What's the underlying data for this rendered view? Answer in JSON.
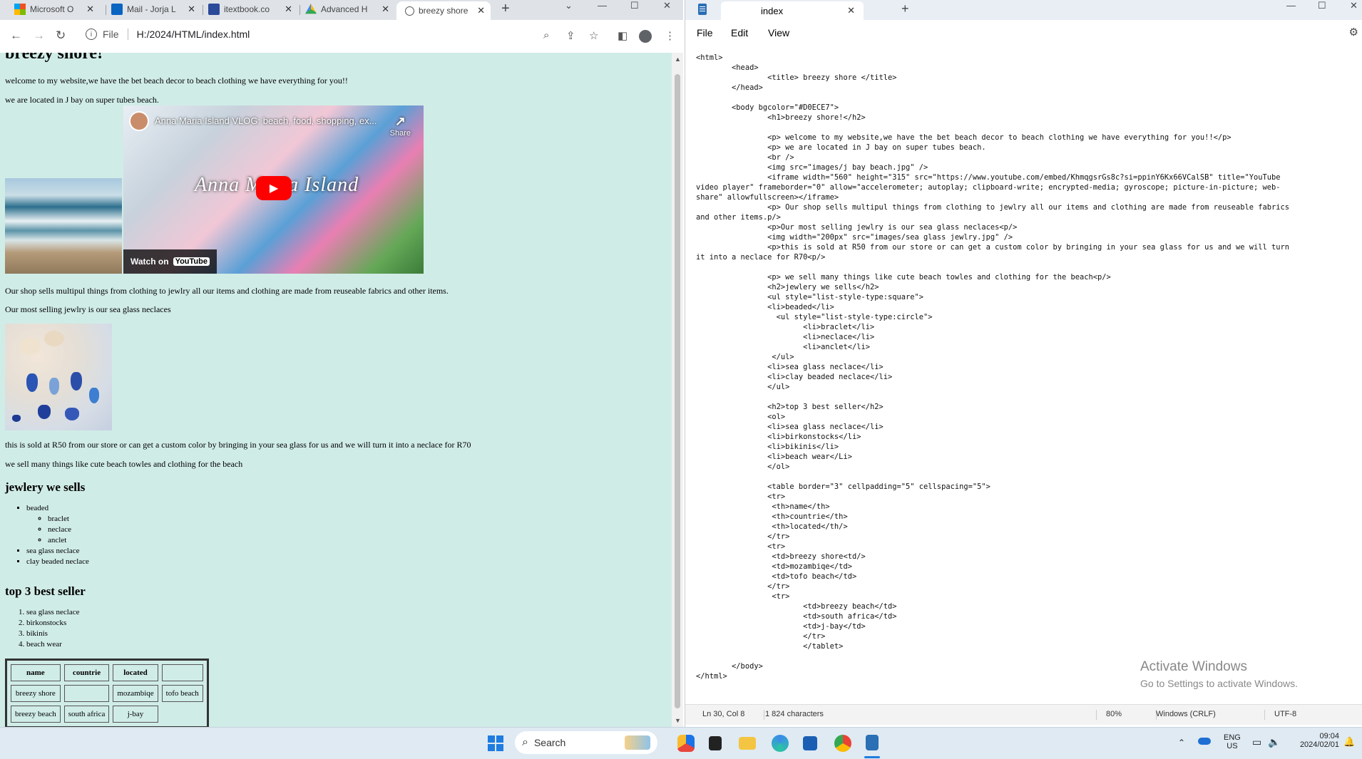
{
  "browser": {
    "tabs": [
      {
        "label": "Microsoft O",
        "icon": "microsoft-icon"
      },
      {
        "label": "Mail - Jorja L",
        "icon": "outlook-icon"
      },
      {
        "label": "itextbook.co",
        "icon": "itextbook-icon"
      },
      {
        "label": "Advanced H",
        "icon": "drive-icon"
      },
      {
        "label": "breezy shore",
        "icon": "globe-icon"
      }
    ],
    "address": {
      "scheme_label": "File",
      "url": "H:/2024/HTML/index.html"
    }
  },
  "page": {
    "heading": "breezy shore!",
    "welcome": "welcome to my website,we have the bet beach decor to beach clothing we have everything for you!!",
    "location": "we are located in J bay on super tubes beach.",
    "video": {
      "title": "Anna Maria Island VLOG: beach, food, shopping, ex...",
      "overlay_text": "Anna Maria Island",
      "share_label": "Share",
      "watch_label": "Watch on",
      "youtube_label": "YouTube"
    },
    "shop_sells": "Our shop sells multipul things from clothing to jewlry all our items and clothing are made from reuseable fabrics and other items.",
    "best_jewelry": "Our most selling jewlry is our sea glass neclaces",
    "price": "this is sold at R50 from our store or can get a custom color by bringing in your sea glass for us and we will turn it into a neclace for R70",
    "sell_things": "we sell many things like cute beach towles and clothing for the beach",
    "jewelry_heading": "jewlery we sells",
    "jewelry_list": [
      "beaded",
      "sea glass neclace",
      "clay beaded neclace"
    ],
    "beaded_sublist": [
      "braclet",
      "neclace",
      "anclet"
    ],
    "best_heading": "top 3 best seller",
    "best_list": [
      "sea glass neclace",
      "birkonstocks",
      "bikinis",
      "beach wear"
    ],
    "table": {
      "headers": [
        "name",
        "countrie",
        "located",
        ""
      ],
      "rows": [
        [
          "breezy shore",
          "",
          "mozambiqe",
          "tofo beach"
        ],
        [
          "breezy beach",
          "south africa",
          "j-bay",
          ""
        ]
      ]
    }
  },
  "notepad": {
    "tab_title": "index",
    "menu": [
      "File",
      "Edit",
      "View"
    ],
    "code": "<html>\n        <head>\n                <title> breezy shore </title>\n        </head>\n\n        <body bgcolor=\"#D0ECE7\">\n                <h1>breezy shore!</h2>\n\n                <p> welcome to my website,we have the bet beach decor to beach clothing we have everything for you!!</p>\n                <p> we are located in J bay on super tubes beach.\n                <br />\n                <img src=\"images/j bay beach.jpg\" />\n                <iframe width=\"560\" height=\"315\" src=\"https://www.youtube.com/embed/KhmqgsrGs8c?si=ppinY6Kx66VCalSB\" title=\"YouTube\nvideo player\" frameborder=\"0\" allow=\"accelerometer; autoplay; clipboard-write; encrypted-media; gyroscope; picture-in-picture; web-\nshare\" allowfullscreen></iframe>\n                <p> Our shop sells multipul things from clothing to jewlry all our items and clothing are made from reuseable fabrics\nand other items.p/>\n                <p>Our most selling jewlry is our sea glass neclaces<p/>\n                <img width=\"200px\" src=\"images/sea glass jewlry.jpg\" />\n                <p>this is sold at R50 from our store or can get a custom color by bringing in your sea glass for us and we will turn\nit into a neclace for R70<p/>\n\n                <p> we sell many things like cute beach towles and clothing for the beach<p/>\n                <h2>jewlery we sells</h2>\n                <ul style=\"list-style-type:square\">\n                <li>beaded</li>\n                  <ul style=\"list-style-type:circle\">\n                        <li>braclet</li>\n                        <li>neclace</li>\n                        <li>anclet</li>\n                 </ul>\n                <li>sea glass neclace</li>\n                <li>clay beaded neclace</li>\n                </ul>\n\n                <h2>top 3 best seller</h2>\n                <ol>\n                <li>sea glass neclace</li>\n                <li>birkonstocks</li>\n                <li>bikinis</li>\n                <li>beach wear</Li>\n                </ol>\n\n                <table border=\"3\" cellpadding=\"5\" cellspacing=\"5\">\n                <tr>\n                 <th>name</th>\n                 <th>countrie</th>\n                 <th>located</th/>\n                </tr>\n                <tr>\n                 <td>breezy shore<td/>\n                 <td>mozambiqe</td>\n                 <td>tofo beach</td>\n                </tr>\n                 <tr>\n                        <td>breezy beach</td>\n                        <td>south africa</td>\n                        <td>j-bay</td>\n                        </tr>\n                        </tablet>\n\n        </body>\n</html>",
    "status": {
      "position": "Ln 30, Col 8",
      "chars": "1 824 characters",
      "zoom": "80%",
      "line_ending": "Windows (CRLF)",
      "encoding": "UTF-8"
    },
    "activate_title": "Activate Windows",
    "activate_sub": "Go to Settings to activate Windows."
  },
  "taskbar": {
    "search_placeholder": "Search",
    "lang": "ENG",
    "region": "US",
    "time": "09:04",
    "date": "2024/02/01"
  },
  "colors": {
    "page_bg": "#D0ECE7",
    "accent": "#1f7ce0"
  }
}
